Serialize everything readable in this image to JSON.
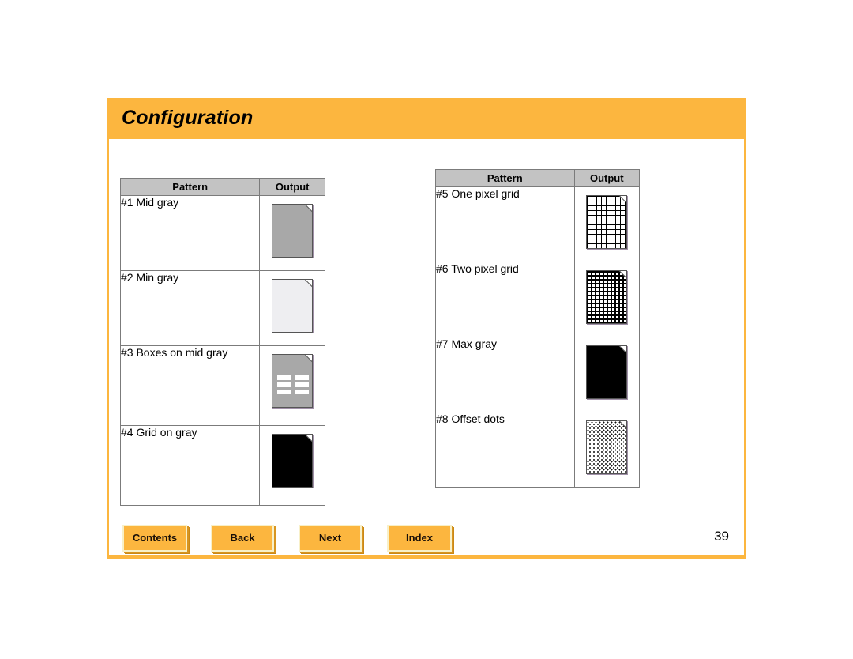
{
  "slide": {
    "title": "Configuration",
    "page_number": "39",
    "accent_color": "#fcb63f",
    "content_background": "#ffffff",
    "header_cell_color": "#c3c3c3"
  },
  "tables": [
    {
      "id": "left",
      "headers": {
        "pattern": "Pattern",
        "output": "Output"
      },
      "rows": [
        {
          "label": "#1 Mid gray",
          "output_icon": "page-mid-gray-icon",
          "fill": "fill-midgray"
        },
        {
          "label": "#2 Min gray",
          "output_icon": "page-min-gray-icon",
          "fill": "fill-mingray"
        },
        {
          "label": "#3 Boxes on mid gray",
          "output_icon": "page-boxes-icon",
          "fill": "fill-boxes"
        },
        {
          "label": "#4 Grid on gray",
          "output_icon": "page-grid-on-gray-icon",
          "fill": "fill-gridgray"
        }
      ]
    },
    {
      "id": "right",
      "headers": {
        "pattern": "Pattern",
        "output": "Output"
      },
      "rows": [
        {
          "label": "#5 One pixel grid",
          "output_icon": "page-one-pixel-grid-icon",
          "fill": "fill-grid1"
        },
        {
          "label": "#6 Two pixel grid",
          "output_icon": "page-two-pixel-grid-icon",
          "fill": "fill-grid2"
        },
        {
          "label": "#7 Max gray",
          "output_icon": "page-max-gray-icon",
          "fill": "fill-black"
        },
        {
          "label": "#8 Offset dots",
          "output_icon": "page-offset-dots-icon",
          "fill": "fill-dots"
        }
      ]
    }
  ],
  "footer": {
    "buttons": [
      {
        "label": "Contents"
      },
      {
        "label": "Back"
      },
      {
        "label": "Next"
      },
      {
        "label": "Index"
      }
    ]
  }
}
